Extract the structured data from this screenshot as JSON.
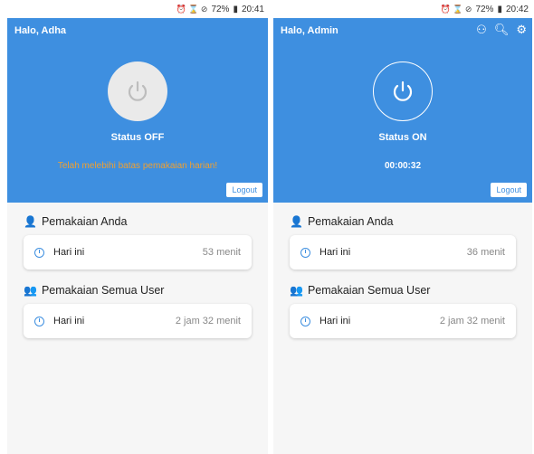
{
  "left": {
    "statusbar": {
      "icons": "⏰ ⌛ ⊘",
      "battery": "72%",
      "time": "20:41"
    },
    "greeting": "Halo, Adha",
    "status": "Status OFF",
    "warning": "Telah melebihi batas pemakaian harian!",
    "logout": "Logout",
    "section1": {
      "title": "Pemakaian Anda",
      "label": "Hari ini",
      "value": "53 menit"
    },
    "section2": {
      "title": "Pemakaian Semua User",
      "label": "Hari ini",
      "value": "2 jam 32 menit"
    }
  },
  "right": {
    "statusbar": {
      "icons": "⏰ ⌛ ⊘",
      "battery": "72%",
      "time": "20:42"
    },
    "greeting": "Halo, Admin",
    "status": "Status ON",
    "timer": "00:00:32",
    "logout": "Logout",
    "header_icons": [
      "users-icon",
      "search-icon",
      "gear-icon"
    ],
    "section1": {
      "title": "Pemakaian Anda",
      "label": "Hari ini",
      "value": "36 menit"
    },
    "section2": {
      "title": "Pemakaian Semua User",
      "label": "Hari ini",
      "value": "2 jam 32 menit"
    }
  },
  "colors": {
    "primary": "#3e8fe0",
    "warning": "#f0a030",
    "power_off": "#eaeaea"
  }
}
